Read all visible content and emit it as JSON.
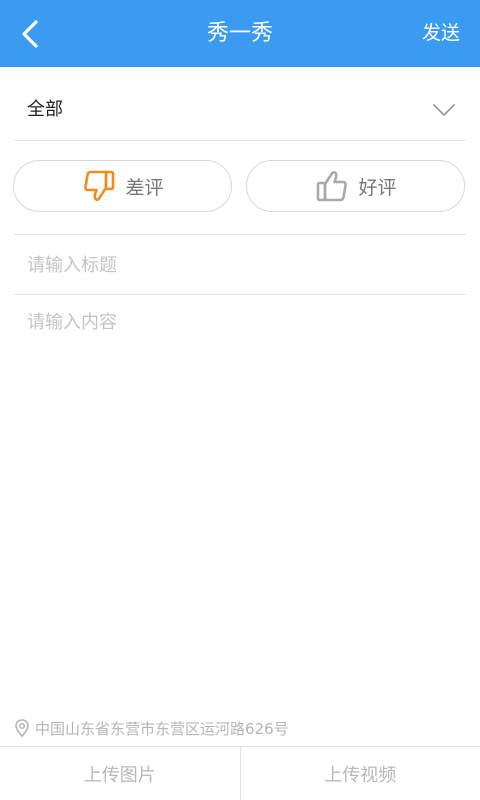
{
  "header": {
    "title": "秀一秀",
    "send_label": "发送"
  },
  "category": {
    "selected": "全部"
  },
  "rating": {
    "bad_label": "差评",
    "good_label": "好评",
    "selected": "bad",
    "active_color": "#f08b1e",
    "inactive_color": "#a9a9a9"
  },
  "form": {
    "title_placeholder": "请输入标题",
    "content_placeholder": "请输入内容"
  },
  "location": {
    "text": "中国山东省东营市东营区运河路626号"
  },
  "bottom": {
    "upload_image_label": "上传图片",
    "upload_video_label": "上传视频"
  },
  "colors": {
    "header_bg": "#3a9bf0"
  }
}
